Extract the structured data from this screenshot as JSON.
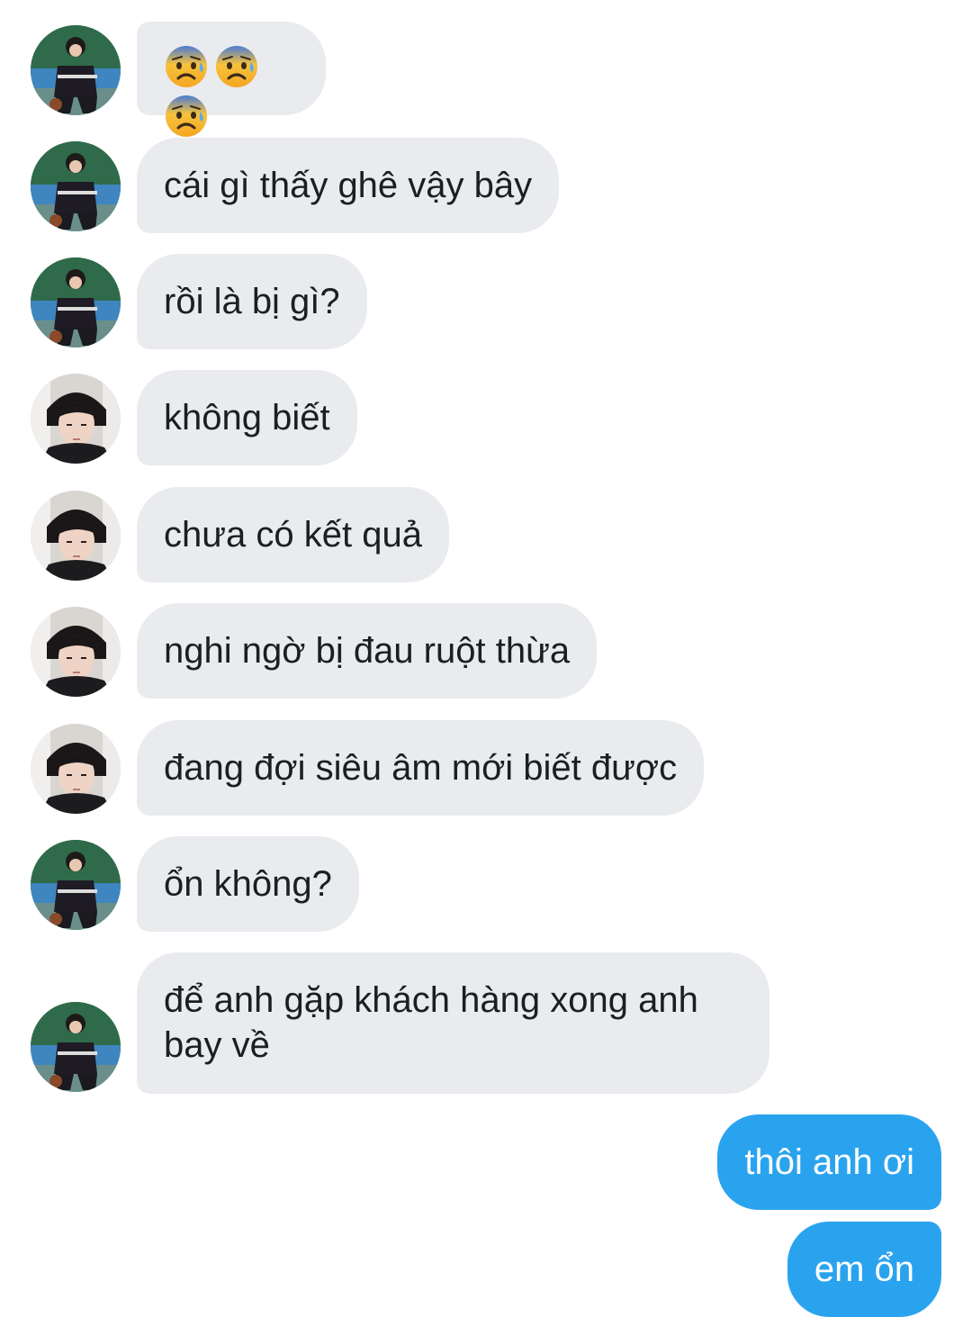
{
  "conversation": {
    "messages": [
      {
        "sender": "other_a",
        "type": "emoji",
        "emoji": [
          "anxious-face-icon",
          "anxious-face-icon",
          "anxious-face-icon"
        ]
      },
      {
        "sender": "other_a",
        "type": "text",
        "text": "cái gì thấy ghê vậy bây"
      },
      {
        "sender": "other_a",
        "type": "text",
        "text": "rồi là bị gì?"
      },
      {
        "sender": "other_b",
        "type": "text",
        "text": "không biết"
      },
      {
        "sender": "other_b",
        "type": "text",
        "text": "chưa có kết quả"
      },
      {
        "sender": "other_b",
        "type": "text",
        "text": "nghi ngờ bị đau ruột thừa"
      },
      {
        "sender": "other_b",
        "type": "text",
        "text": "đang đợi siêu âm mới biết được"
      },
      {
        "sender": "other_a",
        "type": "text",
        "text": "ổn không?"
      },
      {
        "sender": "other_a",
        "type": "text",
        "text": "để anh gặp khách hàng xong anh bay về"
      },
      {
        "sender": "me",
        "type": "text",
        "text": "thôi anh ơi"
      },
      {
        "sender": "me",
        "type": "text",
        "text": "em ổn"
      }
    ]
  },
  "colors": {
    "incoming_bubble": "#e9ebee",
    "outgoing_bubble": "#2aa3ef",
    "incoming_text": "#1c1e21",
    "outgoing_text": "#ffffff"
  }
}
